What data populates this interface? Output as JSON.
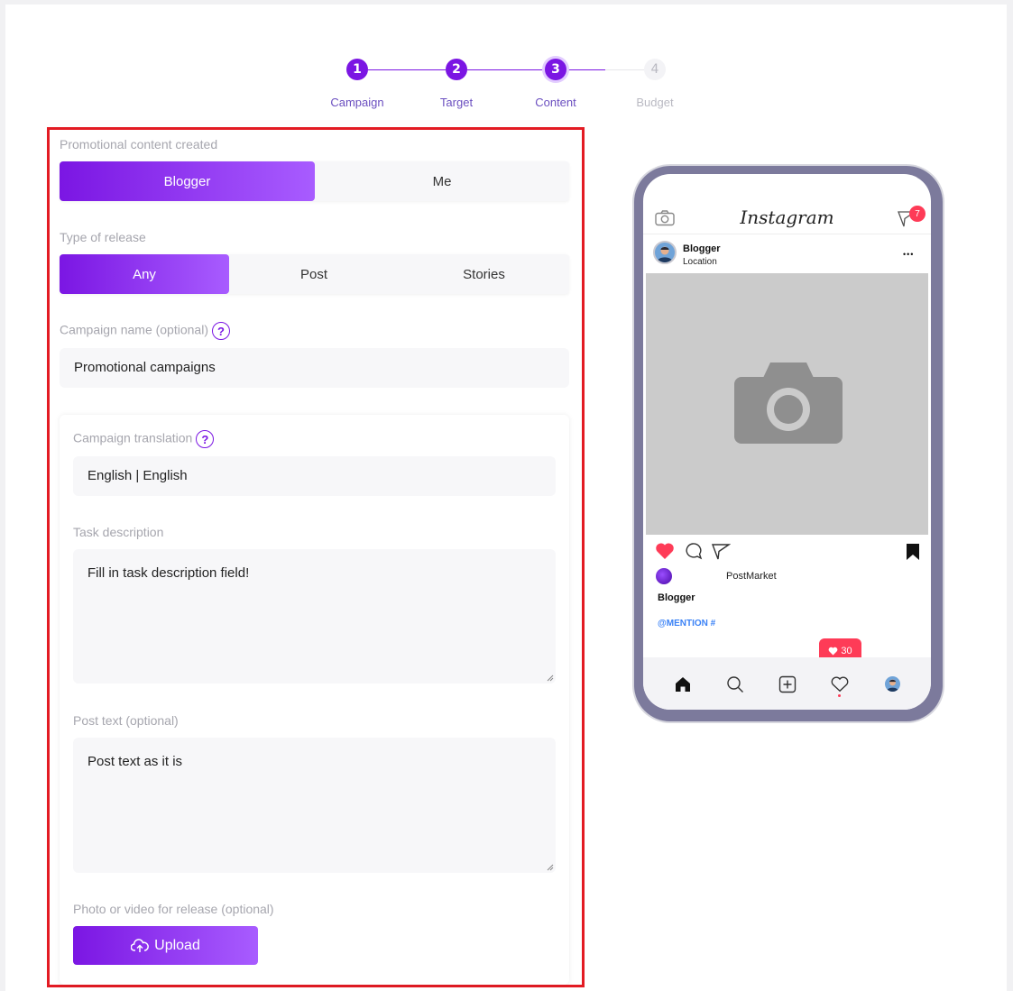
{
  "stepper": {
    "steps": [
      {
        "number": "1",
        "label": "Campaign",
        "state": "done"
      },
      {
        "number": "2",
        "label": "Target",
        "state": "done"
      },
      {
        "number": "3",
        "label": "Content",
        "state": "active"
      },
      {
        "number": "4",
        "label": "Budget",
        "state": "pending"
      }
    ],
    "active_color": "#7b16e3",
    "pending_color": "#c9c9d1"
  },
  "form": {
    "promo_label": "Promotional content created",
    "promo_options": [
      {
        "label": "Blogger",
        "active": true
      },
      {
        "label": "Me",
        "active": false
      }
    ],
    "release_label": "Type of release",
    "release_options": [
      {
        "label": "Any",
        "active": true
      },
      {
        "label": "Post",
        "active": false
      },
      {
        "label": "Stories",
        "active": false
      }
    ],
    "campaign_name_label": "Campaign name (optional)",
    "campaign_name_value": "Promotional campaigns",
    "translation_label": "Campaign translation",
    "translation_value": "English | English",
    "task_label": "Task description",
    "task_value": "Fill  in task description field!",
    "post_text_label": "Post text (optional)",
    "post_text_value": "Post text as it is",
    "media_label": "Photo or video for release (optional)",
    "upload_label": "Upload",
    "help_glyph": "?"
  },
  "preview": {
    "app_title": "Instagram",
    "notification_count": "7",
    "username": "Blogger",
    "location": "Location",
    "more_glyph": "•••",
    "brand_name": "PostMarket",
    "caption_user": "Blogger",
    "mention_text": "@MENTION #",
    "likes_count": "30",
    "heart_color": "#fe3b57"
  }
}
